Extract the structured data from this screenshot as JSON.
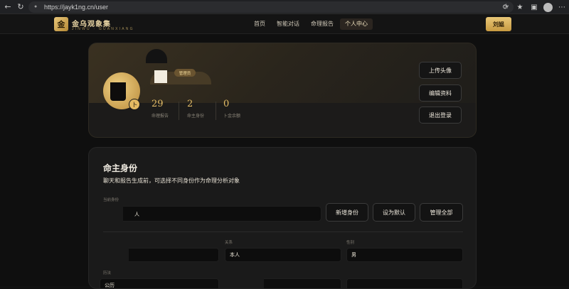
{
  "browser": {
    "url": "https://jayk1ng.cn/user"
  },
  "site": {
    "logo_char": "金",
    "logo_title": "金乌观象集",
    "logo_subtitle": "JINWU · GUANXIANG",
    "nav": [
      "首页",
      "智能对话",
      "命理报告",
      "个人中心"
    ],
    "active_nav": "个人中心",
    "user_button": "刘媪"
  },
  "profile": {
    "avatar_badge": "卜",
    "role_badge": "管理员",
    "stats": [
      {
        "value": "29",
        "label": "命理报告"
      },
      {
        "value": "2",
        "label": "命主身份"
      },
      {
        "value": "0",
        "label": "卜金余额"
      }
    ],
    "buttons": [
      "上传头像",
      "编辑资料",
      "退出登录"
    ]
  },
  "identity": {
    "title": "命主身份",
    "subtitle": "聊天和报告生成前，可选择不同身份作为命理分析对象",
    "current_label": "当前身份",
    "current_value": "人",
    "buttons": [
      "新增身份",
      "设为默认",
      "管理全部"
    ],
    "fields": [
      {
        "label": "",
        "value": ""
      },
      {
        "label": "关系",
        "value": "本人"
      },
      {
        "label": "性别",
        "value": "男"
      }
    ],
    "row2_labels": [
      "历法",
      "",
      ""
    ],
    "row2_value": "公历"
  }
}
